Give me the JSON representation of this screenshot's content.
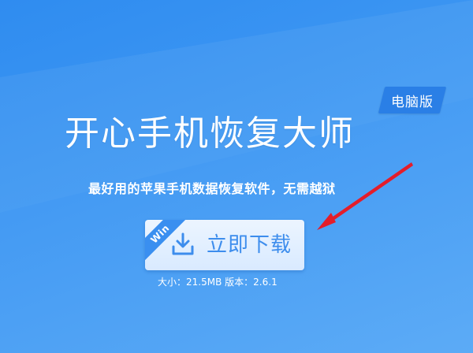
{
  "badge": {
    "label": "电脑版"
  },
  "title": "开心手机恢复大师",
  "subtitle": "最好用的苹果手机数据恢复软件，无需越狱",
  "download": {
    "label": "立即下载",
    "platform": "Win"
  },
  "info": {
    "size_label": "大小：",
    "size_value": "21.5MB",
    "version_label": "版本：",
    "version_value": "2.6.1"
  },
  "colors": {
    "background_start": "#2f8cf0",
    "background_end": "#56a8f6",
    "accent": "#3d8ded",
    "badge": "#2a7fe6",
    "arrow": "#e41d2a"
  },
  "icons": {
    "download": "download-icon",
    "annotation": "arrow-icon"
  }
}
